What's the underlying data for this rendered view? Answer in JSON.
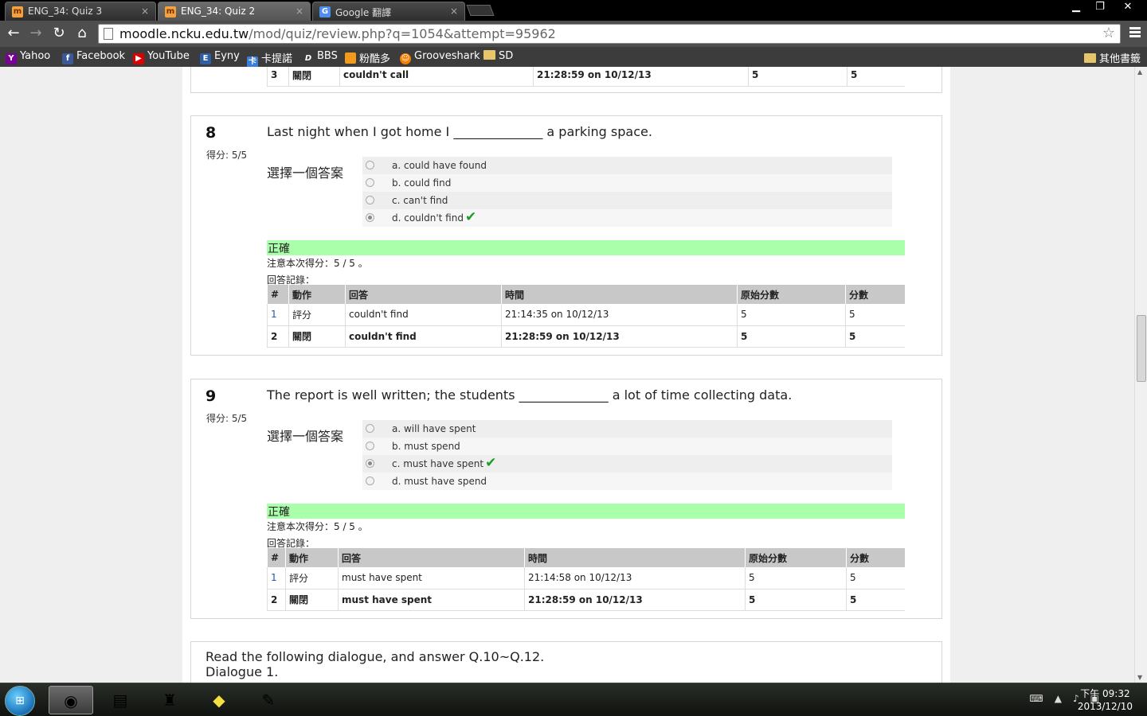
{
  "browser": {
    "tabs": [
      {
        "title": "ENG_34: Quiz 3",
        "icon": "moodle-icon"
      },
      {
        "title": "ENG_34: Quiz 2",
        "icon": "moodle-icon"
      },
      {
        "title": "Google 翻譯",
        "icon": "google-translate-icon"
      }
    ],
    "tab_close": "×",
    "url_host": "moodle.ncku.edu.tw",
    "url_path": "/mod/quiz/review.php?q=1054&attempt=95962",
    "bookmarks": [
      "Yahoo",
      "Facebook",
      "YouTube",
      "Eyny",
      "卡提諾",
      "BBS",
      "粉酷多",
      "Grooveshark",
      "SD"
    ],
    "other_bookmarks": "其他書籤"
  },
  "q7_tail": {
    "row": {
      "num": "3",
      "action": "關閉",
      "answer": "couldn't call",
      "time": "21:28:59 on 10/12/13",
      "raw": "5",
      "score": "5"
    }
  },
  "questions": [
    {
      "number": "8",
      "grade": "得分: 5/5",
      "text": "Last night when I got home I ______________ a parking space.",
      "prompt": "選擇一個答案",
      "options": [
        "a. could have found",
        "b. could find",
        "c. can't find",
        "d. couldn't find"
      ],
      "selected": 3,
      "feedback": "正確",
      "note": "注意本次得分：5 / 5 。",
      "history_label": "回答記錄：",
      "headers": [
        "#",
        "動作",
        "回答",
        "時間",
        "原始分數",
        "分數"
      ],
      "rows": [
        {
          "num": "1",
          "action": "評分",
          "answer": "couldn't find",
          "time": "21:14:35 on 10/12/13",
          "raw": "5",
          "score": "5"
        },
        {
          "num": "2",
          "action": "關閉",
          "answer": "couldn't find",
          "time": "21:28:59 on 10/12/13",
          "raw": "5",
          "score": "5"
        }
      ]
    },
    {
      "number": "9",
      "grade": "得分: 5/5",
      "text": "The report is well written; the students ______________ a lot of time collecting data.",
      "prompt": "選擇一個答案",
      "options": [
        "a. will have spent",
        "b. must spend",
        "c. must have spent",
        "d. must have spend"
      ],
      "selected": 2,
      "feedback": "正確",
      "note": "注意本次得分：5 / 5 。",
      "history_label": "回答記錄：",
      "headers": [
        "#",
        "動作",
        "回答",
        "時間",
        "原始分數",
        "分數"
      ],
      "rows": [
        {
          "num": "1",
          "action": "評分",
          "answer": "must have spent",
          "time": "21:14:58 on 10/12/13",
          "raw": "5",
          "score": "5"
        },
        {
          "num": "2",
          "action": "關閉",
          "answer": "must have spent",
          "time": "21:28:59 on 10/12/13",
          "raw": "5",
          "score": "5"
        }
      ]
    }
  ],
  "dialogue": {
    "line1": "Read the following dialogue, and answer Q.10~Q.12.",
    "line2": "Dialogue 1."
  },
  "taskbar": {
    "clock_time": "下午 09:32",
    "clock_date": "2013/12/10"
  }
}
